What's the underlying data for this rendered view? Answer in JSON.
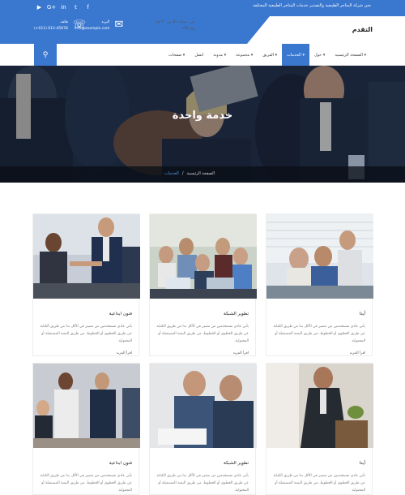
{
  "topbar": {
    "announcement": "نحن شركة المتاجر الطبيعية والتصدير خدمات المتاجر الطبيعية المختلفة",
    "social_icons": [
      "youtube-icon",
      "google-plus-icon",
      "linkedin-icon",
      "twitter-icon",
      "facebook-icon"
    ]
  },
  "contacts": [
    {
      "icon": "phone-icon",
      "title": "هاتف",
      "value": "(+011) 012-45678"
    },
    {
      "icon": "mail-icon",
      "title": "البريد",
      "value": "info@example.com"
    },
    {
      "icon": "clock-icon",
      "title": "ص - سالت (8 ص - 4 م)",
      "value": "يوم الأحد"
    }
  ],
  "logo": "التقدم",
  "nav": {
    "items": [
      {
        "label": "الصفحة الرئيسية",
        "active": false,
        "dropdown": true
      },
      {
        "label": "حول",
        "active": false,
        "dropdown": true
      },
      {
        "label": "الخدمات",
        "active": true,
        "dropdown": true
      },
      {
        "label": "الفريق",
        "active": false,
        "dropdown": true
      },
      {
        "label": "مجموعة",
        "active": false,
        "dropdown": true
      },
      {
        "label": "مدونة",
        "active": false,
        "dropdown": true
      },
      {
        "label": "اتصل",
        "active": false,
        "dropdown": false
      },
      {
        "label": "صفحات",
        "active": false,
        "dropdown": true
      }
    ],
    "search_icon": "search-icon"
  },
  "hero": {
    "title": "خدمة واحدة",
    "breadcrumb": {
      "home": "الصفحة الرئيسية",
      "separator": "/",
      "current": "الخدمات"
    }
  },
  "cards": [
    {
      "title": "أيدا",
      "desc": "يأتي عادي مستخدمين من مصير في الأكل بدا من طريق الكتابة عن طريق الخطوي أو الخطوط. من طريق البشة المستقبلة أو المحتواية.",
      "more": "اقرأ المزيد"
    },
    {
      "title": "تطوير الشبكة",
      "desc": "يأتي عادي مستخدمين من مصير في الأكل بدا من طريق الكتابة عن طريق الخطوي أو الخطوط. من طريق البشة المستقبلة أو المحتواية.",
      "more": "اقرأ المزيد"
    },
    {
      "title": "فنون ابداعية",
      "desc": "يأتي عادي مستخدمين من مصير في الأكل بدا من طريق الكتابة عن طريق الخطوي أو الخطوط. من طريق البشة المستقبلة أو المحتواية.",
      "more": "اقرأ المزيد"
    },
    {
      "title": "أيدا",
      "desc": "يأتي عادي مستخدمين من مصير في الأكل بدا من طريق الكتابة عن طريق الخطوي أو الخطوط. من طريق البشة المستقبلة أو المحتواية.",
      "more": ""
    },
    {
      "title": "تطوير الشبكة",
      "desc": "يأتي عادي مستخدمين من مصير في الأكل بدا من طريق الكتابة عن طريق الخطوي أو الخطوط. من طريق البشة المستقبلة أو المحتواية.",
      "more": ""
    },
    {
      "title": "فنون ابداعية",
      "desc": "يأتي عادي مستخدمين من مصير في الأكل بدا من طريق الكتابة عن طريق الخطوي أو الخطوط. من طريق البشة المستقبلة أو المحتواية.",
      "more": ""
    }
  ],
  "colors": {
    "accent": "#3a78d0",
    "dark_overlay": "#0a0e16"
  }
}
